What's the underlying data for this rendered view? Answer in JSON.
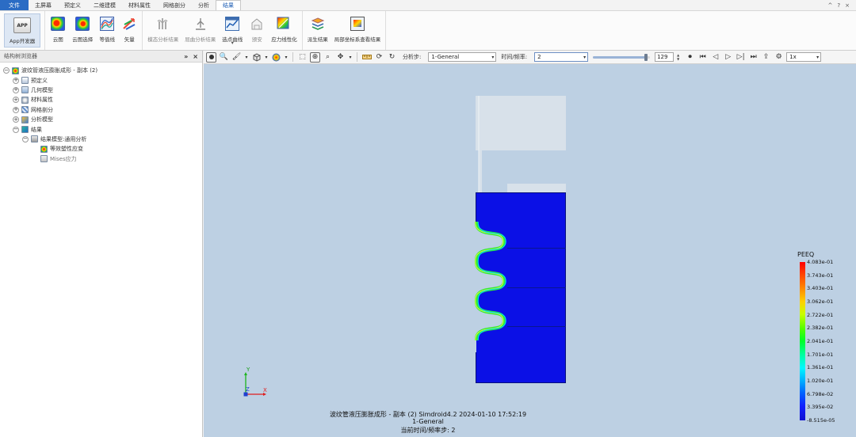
{
  "menu": {
    "tabs": [
      "文件",
      "主屏幕",
      "预定义",
      "二维建模",
      "材料属性",
      "网格剖分",
      "分析",
      "结果"
    ],
    "active_index": 7,
    "window_controls": [
      "^",
      "?",
      "×"
    ]
  },
  "ribbon": {
    "buttons": [
      {
        "label": "App开发器",
        "icon": "app-developer-icon",
        "icon_text": "APP"
      },
      {
        "label": "云图",
        "icon": "contour-icon"
      },
      {
        "label": "云图选择",
        "icon": "contour-select-icon"
      },
      {
        "label": "等值线",
        "icon": "isoline-icon"
      },
      {
        "label": "矢量",
        "icon": "vector-icon"
      },
      {
        "label": "模态分析结果",
        "icon": "modal-result-icon"
      },
      {
        "label": "屈曲分析结果",
        "icon": "buckling-result-icon"
      },
      {
        "label": "选点曲线",
        "icon": "point-curve-icon"
      },
      {
        "label": "颁安",
        "icon": "probe-icon"
      },
      {
        "label": "应力线性化",
        "icon": "stress-linearization-icon"
      },
      {
        "label": "派生结果",
        "icon": "derived-result-icon"
      },
      {
        "label": "局部坐标系查看结果",
        "icon": "local-coordinate-result-icon"
      }
    ]
  },
  "left_panel": {
    "title": "结构树浏览器",
    "tree": [
      {
        "level": 0,
        "label": "波纹管液压膨胀成形 - 副本 (2)",
        "expander": "−",
        "icon": "model-icon"
      },
      {
        "level": 1,
        "label": "预定义",
        "expander": "+",
        "icon": "predefine-icon"
      },
      {
        "level": 1,
        "label": "几何模型",
        "expander": "+",
        "icon": "geometry-icon"
      },
      {
        "level": 1,
        "label": "材料属性",
        "expander": "+",
        "icon": "material-icon"
      },
      {
        "level": 1,
        "label": "网格剖分",
        "expander": "+",
        "icon": "mesh-icon"
      },
      {
        "level": 1,
        "label": "分析模型",
        "expander": "+",
        "icon": "analysis-icon"
      },
      {
        "level": 1,
        "label": "结果",
        "expander": "−",
        "icon": "result-icon"
      },
      {
        "level": 2,
        "label": "结果模型:通用分析",
        "expander": "−",
        "icon": "result-model-icon"
      },
      {
        "level": 3,
        "label": "等效塑性应变",
        "expander": "",
        "icon": "plastic-strain-icon"
      },
      {
        "level": 3,
        "label": "Mises应力",
        "expander": "",
        "icon": "mises-icon",
        "muted": true
      }
    ]
  },
  "viewport_toolbar": {
    "step_label": "分析步:",
    "step_value": "1-General",
    "time_label": "时间/频率:",
    "time_value": "2",
    "frame_value": "129",
    "frame_fraction": 0.93,
    "speed_value": "1x"
  },
  "viewport": {
    "caption_line1": "波纹管液压膨胀成形 - 副本 (2)  Simdroid4.2  2024-01-10 17:52:19",
    "caption_line2": "1-General",
    "caption_line3": "当前时间/频率步:  2",
    "axis_labels": {
      "y": "Y",
      "z": "Z",
      "x": "X"
    }
  },
  "legend": {
    "title": "PEEQ",
    "values": [
      "4.083e-01",
      "3.743e-01",
      "3.403e-01",
      "3.062e-01",
      "2.722e-01",
      "2.382e-01",
      "2.041e-01",
      "1.701e-01",
      "1.361e-01",
      "1.020e-01",
      "6.798e-02",
      "3.395e-02",
      "-8.515e-05"
    ]
  }
}
